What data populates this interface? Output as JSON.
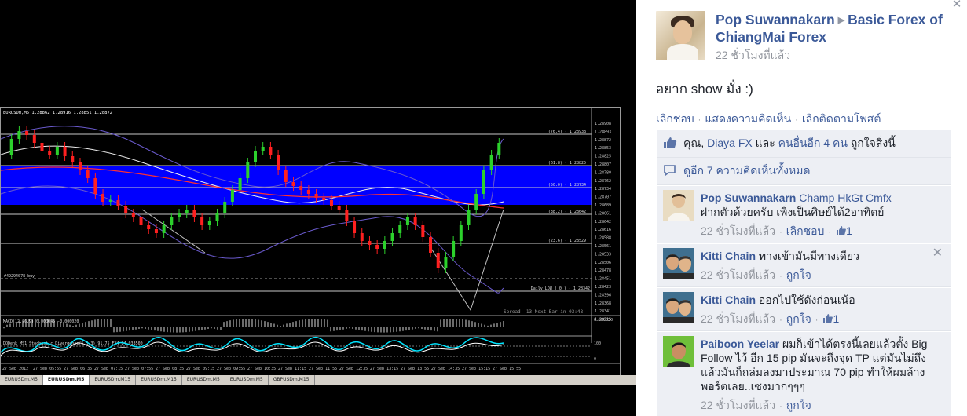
{
  "chart": {
    "title": "EURUSDm,M5  1.28862 1.28916 1.28851 1.28872",
    "price_labels": [
      "1.28908",
      "1.28893",
      "1.28872",
      "1.28853",
      "1.28825",
      "1.28807",
      "1.28780",
      "1.28762",
      "1.28734",
      "1.28707",
      "1.28689",
      "1.28661",
      "1.28642",
      "1.28616",
      "1.28588",
      "1.28561",
      "1.28533",
      "1.28506",
      "1.28478",
      "1.28451",
      "1.28423",
      "1.28396",
      "1.28368",
      "1.28341",
      "1.28315"
    ],
    "fib_labels": [
      "(76.4) - 1.28938",
      "(61.8) - 1.28825",
      "(50.0) - 1.28734",
      "(38.2) - 1.28642",
      "(23.6) - 1.28529",
      "Daily LOW ( 0 ) - 1.28342"
    ],
    "order_label": "#49294078 buy",
    "spread_text": "Spread: 13   Next Bar in 03:48",
    "macd_title": "MACD(12,26,9) 0.000045 -0.000020",
    "macd_right": "0.000050",
    "osc_title": "DODenk MS1 Stochastic Divergence(5,3,3) 91.75  FX4 84.033500",
    "osc_right": "100",
    "osc_right2": "0",
    "time_labels": [
      "27 Sep 2012",
      "27 Sep 05:55",
      "27 Sep 06:35",
      "27 Sep 07:15",
      "27 Sep 07:55",
      "27 Sep 08:35",
      "27 Sep 09:15",
      "27 Sep 09:55",
      "27 Sep 10:35",
      "27 Sep 11:15",
      "27 Sep 11:55",
      "27 Sep 12:35",
      "27 Sep 13:15",
      "27 Sep 13:55",
      "27 Sep 14:35",
      "27 Sep 15:15",
      "27 Sep 15:55"
    ],
    "tabs": [
      "EURUSDm,M5",
      "EURUSDm,M5",
      "EURUSDm,M15",
      "EURUSDm,M15",
      "EURUSDm,M5",
      "EURUSDm,M5",
      "GBPUSDm,M15"
    ]
  },
  "post": {
    "author": "Pop Suwannakarn",
    "target": "Basic Forex of ChiangMai Forex",
    "time": "22 ชั่วโมงที่แล้ว",
    "text": "อยาก show มั่ง :)",
    "actions": [
      "เลิกชอบ",
      "แสดงความคิดเห็น",
      "เลิกติดตามโพสต์"
    ]
  },
  "likes": {
    "prefix": "คุณ, ",
    "friend": "Diaya FX",
    "middle": " และ ",
    "others": "คนอื่นอีก 4 คน",
    "suffix": " ถูกใจสิ่งนี้"
  },
  "view_all": "ดูอีก 7 ความคิดเห็นทั้งหมด",
  "comments": [
    {
      "name": "Pop Suwannakarn",
      "tags": "Champ HkGt Cmfx",
      "text": "ฝากตัวด้วยครับ เพิ่งเป็นศิษย์ได้2อาทิตย์",
      "time": "22 ชั่วโมงที่แล้ว",
      "action": "เลิกชอบ",
      "likes": "1"
    },
    {
      "name": "Kitti Chain",
      "text": "ทางเข้ามันมีทางเดียว",
      "time": "22 ชั่วโมงที่แล้ว",
      "action": "ถูกใจ",
      "likes": ""
    },
    {
      "name": "Kitti Chain",
      "text": "ออกไปใช้ดังก่อนเน้อ",
      "time": "22 ชั่วโมงที่แล้ว",
      "action": "ถูกใจ",
      "likes": "1"
    },
    {
      "name": "Paiboon Yeelar",
      "text": "ผมก็เข้าได้ตรงนี้เลยแล้วตั้ง Big Follow ไว้ อีก 15 pip มันจะถึงจุด TP แต่มันไม่ถึงแล้วมันก็ถล่มลงมาประมาณ 70 pip ทำให้ผมล้างพอร์ตเลย..เซงมากๆๆๆ",
      "time": "22 ชั่วโมงที่แล้ว",
      "action": "ถูกใจ",
      "likes": ""
    }
  ],
  "colors": {
    "fb_blue": "#3b5998",
    "muted": "#90949c",
    "ufi_bg": "#edeff4",
    "zone_blue": "#0000ff"
  }
}
